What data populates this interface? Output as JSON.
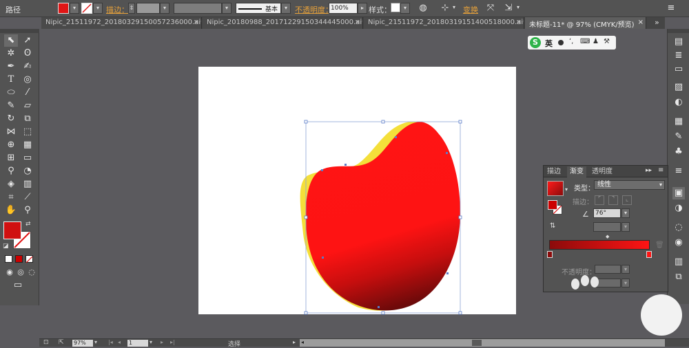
{
  "control_bar": {
    "object_type": "路径",
    "stroke_label": "描边：",
    "opacity_label": "不透明度：",
    "opacity_value": "100%",
    "brush_label": "基本",
    "style_label": "样式：",
    "transform_label": "变换"
  },
  "tabs": [
    {
      "label": "Nipic_21511972_20180329150057236000.ai*...",
      "close": "×"
    },
    {
      "label": "Nipic_20180988_20171229150344445000.ai*...",
      "close": "×"
    },
    {
      "label": "Nipic_21511972_20180319151400518000.ai*...",
      "close": "×"
    },
    {
      "label": "未标题-11* @ 97% (CMYK/预览)",
      "close": "×"
    }
  ],
  "ime": {
    "logo": "S",
    "lang": "英"
  },
  "gradient_panel": {
    "tabs": [
      "描边",
      "渐变",
      "透明度"
    ],
    "type_label": "类型：",
    "type_value": "线性",
    "stroke_label": "描边：",
    "angle_value": "76°",
    "opacity_label": "不透明度："
  },
  "status": {
    "zoom": "97%",
    "page": "1",
    "mode": "选择"
  },
  "colors": {
    "fill": "#ee1111",
    "shape_red": "#ff1212",
    "shape_dark": "#7a0b0b",
    "shadow_yellow": "#f6e23a",
    "accent_orange": "#e8a23a"
  }
}
